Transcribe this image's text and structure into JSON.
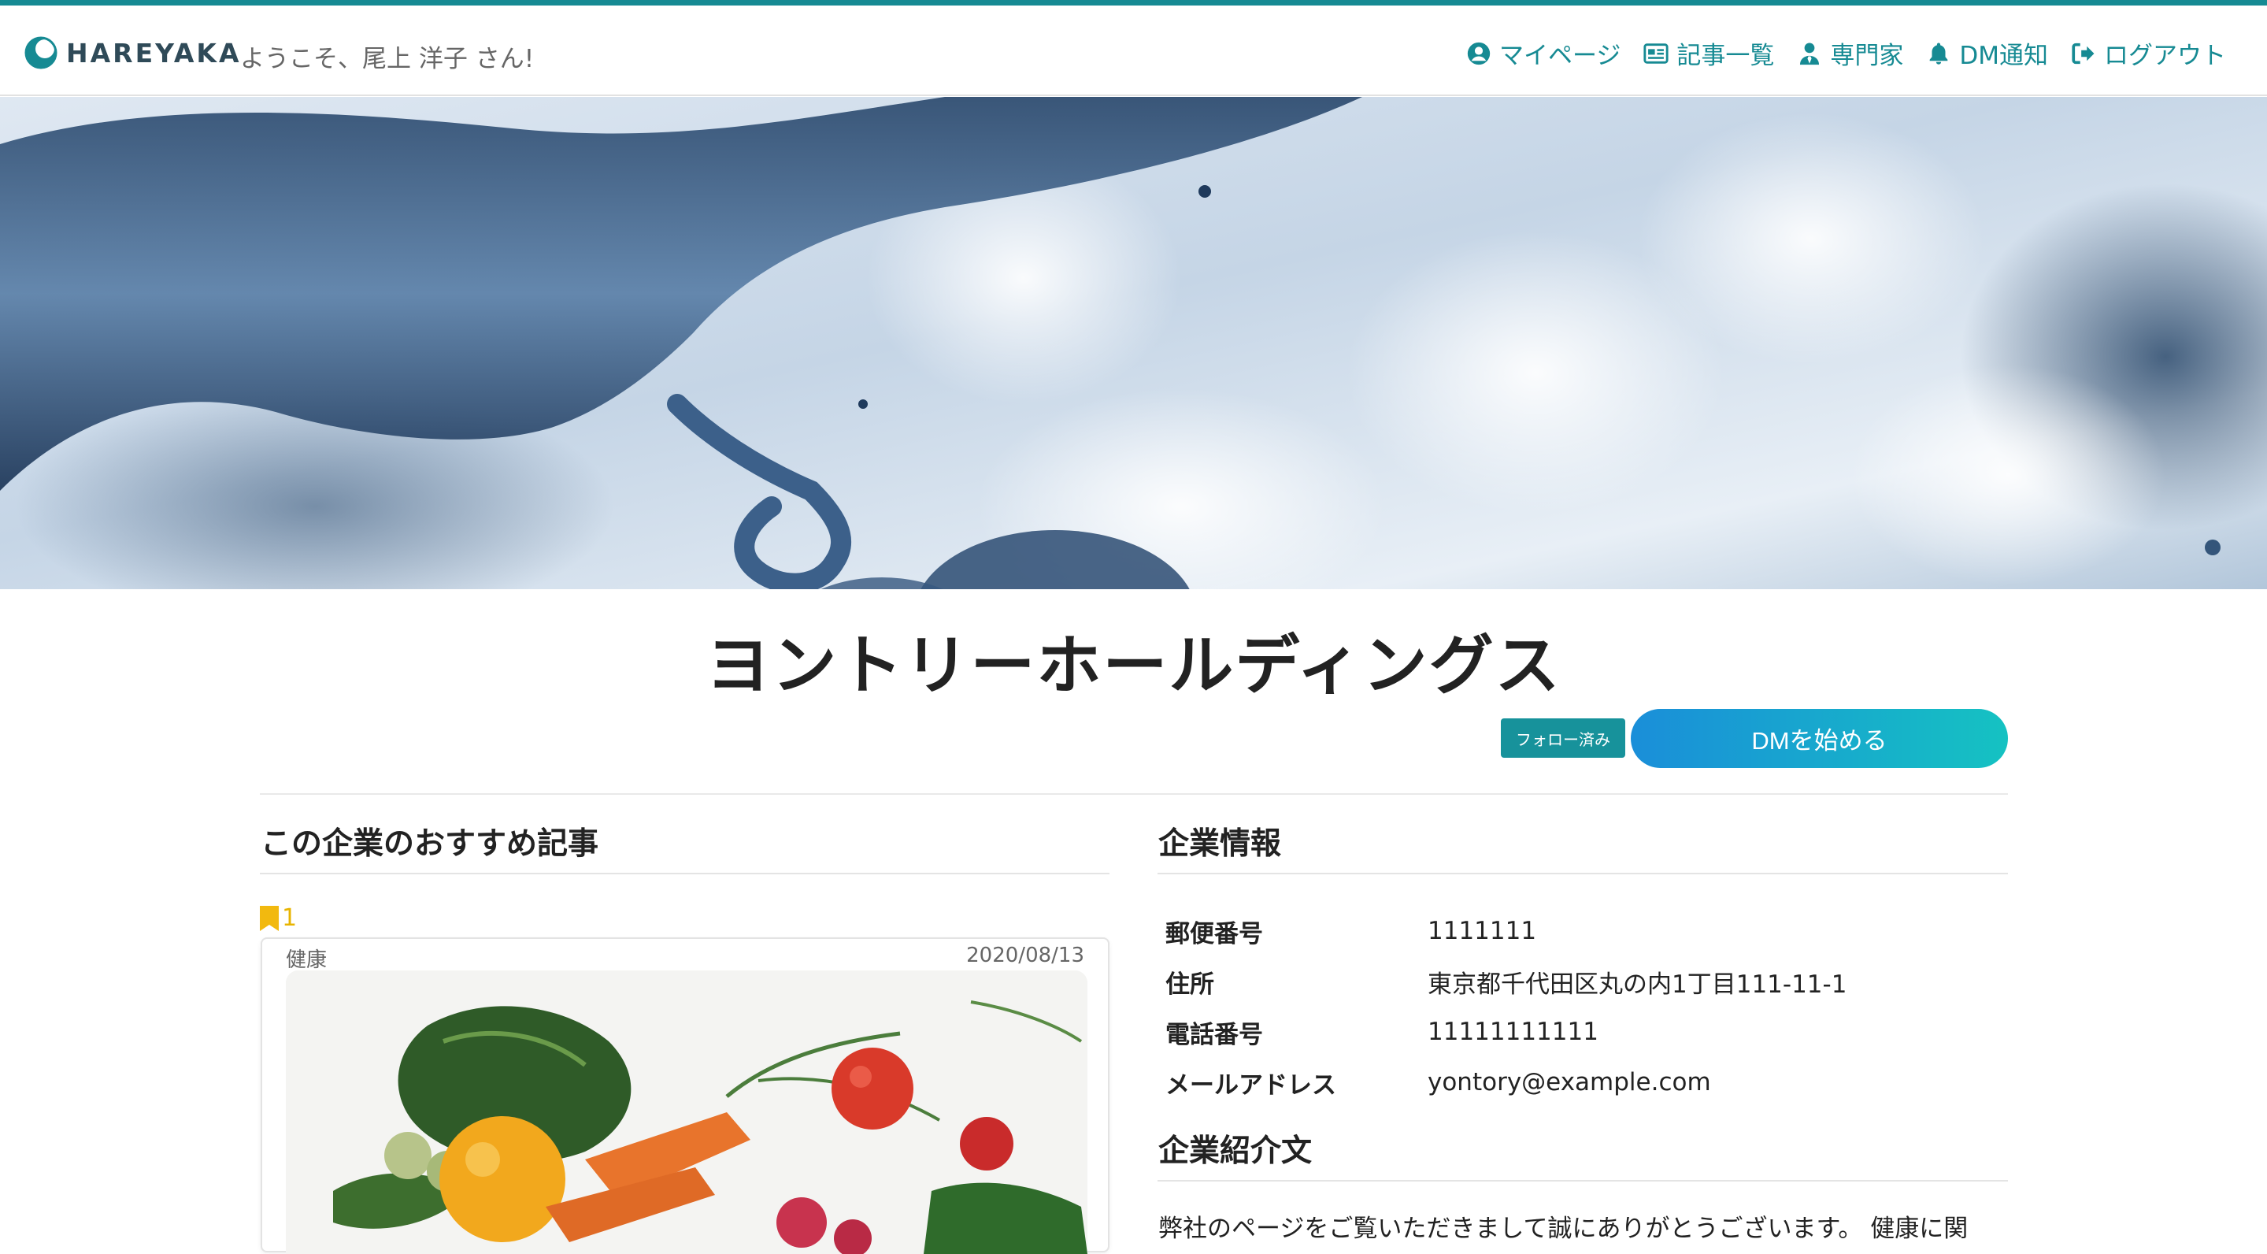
{
  "brand": {
    "name": "HAREYAKA",
    "accent_color": "#168a93"
  },
  "header": {
    "welcome": "ようこそ、尾上 洋子 さん!"
  },
  "nav": {
    "items": [
      {
        "label": "マイページ",
        "icon": "user-circle-icon"
      },
      {
        "label": "記事一覧",
        "icon": "newspaper-icon"
      },
      {
        "label": "専門家",
        "icon": "user-tie-icon"
      },
      {
        "label": "DM通知",
        "icon": "bell-icon"
      },
      {
        "label": "ログアウト",
        "icon": "sign-out-icon"
      }
    ]
  },
  "company": {
    "name": "ヨントリーホールディングス",
    "follow_status": "フォロー済み",
    "dm_button": "DMを始める"
  },
  "recommended": {
    "heading": "この企業のおすすめ記事",
    "articles": [
      {
        "bookmarks": "1",
        "category": "健康",
        "date": "2020/08/13"
      }
    ]
  },
  "company_info": {
    "heading": "企業情報",
    "rows": [
      {
        "label": "郵便番号",
        "value": "1111111"
      },
      {
        "label": "住所",
        "value": "東京都千代田区丸の内1丁目111-11-1"
      },
      {
        "label": "電話番号",
        "value": "11111111111"
      },
      {
        "label": "メールアドレス",
        "value": "yontory@example.com"
      }
    ]
  },
  "intro": {
    "heading": "企業紹介文",
    "text": "弊社のページをご覧いただきまして誠にありがとうございます。 健康に関"
  }
}
